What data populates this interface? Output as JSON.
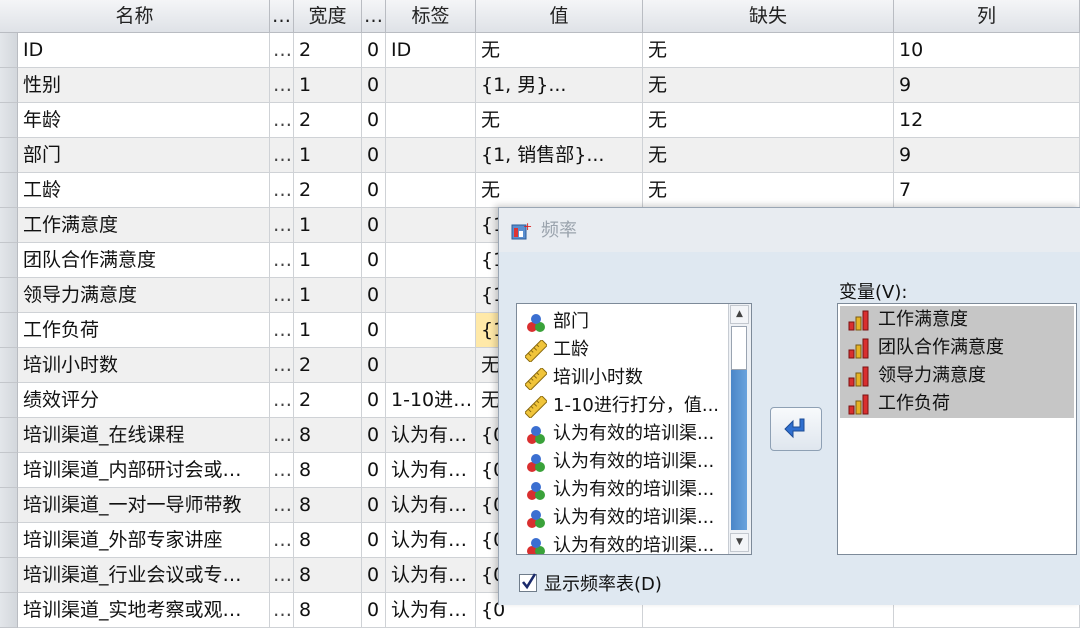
{
  "grid": {
    "headers": [
      "名称",
      "…",
      "宽度",
      "…",
      "标签",
      "值",
      "缺失",
      "列"
    ],
    "rows": [
      {
        "name": "ID",
        "dot": "…",
        "width": "2",
        "dec": "0",
        "label": "ID",
        "values": "无",
        "missing": "无",
        "columns": "10"
      },
      {
        "name": "性别",
        "dot": "…",
        "width": "1",
        "dec": "0",
        "label": "",
        "values": "{1, 男}...",
        "missing": "无",
        "columns": "9"
      },
      {
        "name": "年龄",
        "dot": "…",
        "width": "2",
        "dec": "0",
        "label": "",
        "values": "无",
        "missing": "无",
        "columns": "12"
      },
      {
        "name": "部门",
        "dot": "…",
        "width": "1",
        "dec": "0",
        "label": "",
        "values": "{1, 销售部}...",
        "missing": "无",
        "columns": "9"
      },
      {
        "name": "工龄",
        "dot": "…",
        "width": "2",
        "dec": "0",
        "label": "",
        "values": "无",
        "missing": "无",
        "columns": "7"
      },
      {
        "name": "工作满意度",
        "dot": "…",
        "width": "1",
        "dec": "0",
        "label": "",
        "values": "{1",
        "missing": "",
        "columns": ""
      },
      {
        "name": "团队合作满意度",
        "dot": "…",
        "width": "1",
        "dec": "0",
        "label": "",
        "values": "{1",
        "missing": "",
        "columns": ""
      },
      {
        "name": "领导力满意度",
        "dot": "…",
        "width": "1",
        "dec": "0",
        "label": "",
        "values": "{1",
        "missing": "",
        "columns": ""
      },
      {
        "name": "工作负荷",
        "dot": "…",
        "width": "1",
        "dec": "0",
        "label": "",
        "values": "{1",
        "missing": "",
        "columns": ""
      },
      {
        "name": "培训小时数",
        "dot": "…",
        "width": "2",
        "dec": "0",
        "label": "",
        "values": "无",
        "missing": "",
        "columns": ""
      },
      {
        "name": "绩效评分",
        "dot": "…",
        "width": "2",
        "dec": "0",
        "label": "1-10进…",
        "values": "无",
        "missing": "",
        "columns": ""
      },
      {
        "name": "培训渠道_在线课程",
        "dot": "…",
        "width": "8",
        "dec": "0",
        "label": "认为有…",
        "values": "{0",
        "missing": "",
        "columns": ""
      },
      {
        "name": "培训渠道_内部研讨会或…",
        "dot": "…",
        "width": "8",
        "dec": "0",
        "label": "认为有…",
        "values": "{0",
        "missing": "",
        "columns": ""
      },
      {
        "name": "培训渠道_一对一导师带教",
        "dot": "…",
        "width": "8",
        "dec": "0",
        "label": "认为有…",
        "values": "{0",
        "missing": "",
        "columns": ""
      },
      {
        "name": "培训渠道_外部专家讲座",
        "dot": "…",
        "width": "8",
        "dec": "0",
        "label": "认为有…",
        "values": "{0",
        "missing": "",
        "columns": ""
      },
      {
        "name": "培训渠道_行业会议或专…",
        "dot": "…",
        "width": "8",
        "dec": "0",
        "label": "认为有…",
        "values": "{0",
        "missing": "",
        "columns": ""
      },
      {
        "name": "培训渠道_实地考察或观…",
        "dot": "…",
        "width": "8",
        "dec": "0",
        "label": "认为有…",
        "values": "{0",
        "missing": "",
        "columns": ""
      }
    ]
  },
  "dialog": {
    "title": "频率",
    "source_items": [
      {
        "label": "部门",
        "icon": "nominal-icon"
      },
      {
        "label": "工龄",
        "icon": "scale-icon"
      },
      {
        "label": "培训小时数",
        "icon": "scale-icon"
      },
      {
        "label": "1-10进行打分，值...",
        "icon": "scale-icon"
      },
      {
        "label": "认为有效的培训渠...",
        "icon": "nominal-icon"
      },
      {
        "label": "认为有效的培训渠...",
        "icon": "nominal-icon"
      },
      {
        "label": "认为有效的培训渠...",
        "icon": "nominal-icon"
      },
      {
        "label": "认为有效的培训渠...",
        "icon": "nominal-icon"
      },
      {
        "label": "认为有效的培训渠...",
        "icon": "nominal-icon"
      }
    ],
    "variables_label": "变量(V):",
    "target_items": [
      {
        "label": "工作满意度",
        "icon": "ordinal-icon"
      },
      {
        "label": "团队合作满意度",
        "icon": "ordinal-icon"
      },
      {
        "label": "领导力满意度",
        "icon": "ordinal-icon"
      },
      {
        "label": "工作负荷",
        "icon": "ordinal-icon"
      }
    ],
    "show_freq_table_label": "显示频率表(D)",
    "show_freq_table_checked": true
  }
}
